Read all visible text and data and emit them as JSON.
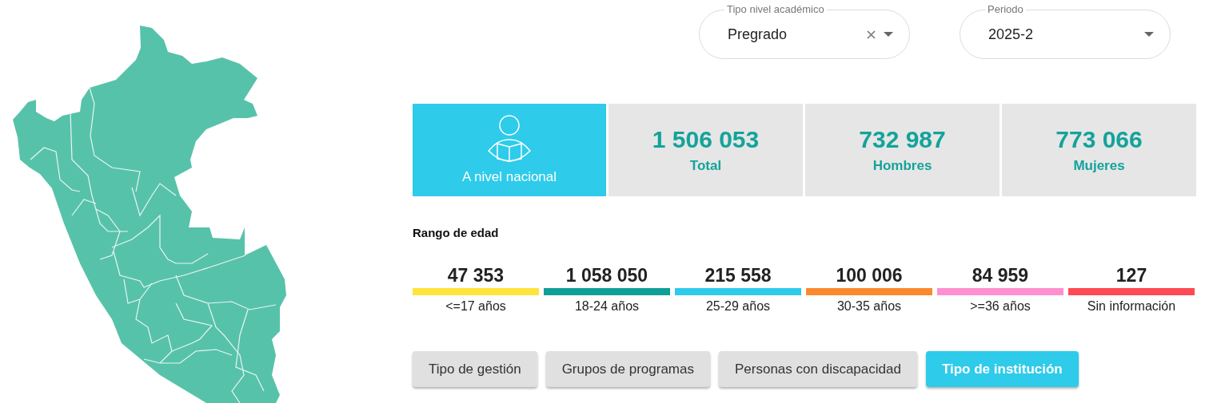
{
  "filters": [
    {
      "label": "Tipo nivel académico",
      "value": "Pregrado",
      "clearable": true
    },
    {
      "label": "Periodo",
      "value": "2025-2",
      "clearable": false
    }
  ],
  "scope_card": {
    "label": "A nivel nacional"
  },
  "stats": [
    {
      "value": "1 506 053",
      "label": "Total"
    },
    {
      "value": "732 987",
      "label": "Hombres"
    },
    {
      "value": "773 066",
      "label": "Mujeres"
    }
  ],
  "age_section": {
    "title": "Rango de edad"
  },
  "age_ranges": [
    {
      "value": "47 353",
      "label": "<=17 años",
      "color": "#ffe53b"
    },
    {
      "value": "1 058 050",
      "label": "18-24 años",
      "color": "#0e9f97"
    },
    {
      "value": "215 558",
      "label": "25-29 años",
      "color": "#2ecbea"
    },
    {
      "value": "100 006",
      "label": "30-35 años",
      "color": "#fb8a2e"
    },
    {
      "value": "84 959",
      "label": ">=36 años",
      "color": "#ff8fd1"
    },
    {
      "value": "127",
      "label": "Sin información",
      "color": "#fe4a55"
    }
  ],
  "tabs": [
    {
      "label": "Tipo de gestión",
      "selected": false
    },
    {
      "label": "Grupos de programas",
      "selected": false
    },
    {
      "label": "Personas con discapacidad",
      "selected": false
    },
    {
      "label": "Tipo de institución",
      "selected": true
    }
  ]
}
